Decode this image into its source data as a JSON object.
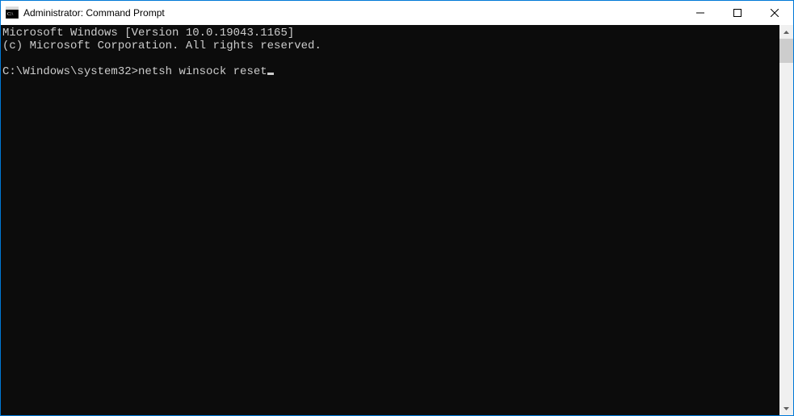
{
  "window": {
    "title": "Administrator: Command Prompt"
  },
  "console": {
    "line1": "Microsoft Windows [Version 10.0.19043.1165]",
    "line2": "(c) Microsoft Corporation. All rights reserved.",
    "blank": "",
    "prompt": "C:\\Windows\\system32>",
    "command": "netsh winsock reset"
  }
}
